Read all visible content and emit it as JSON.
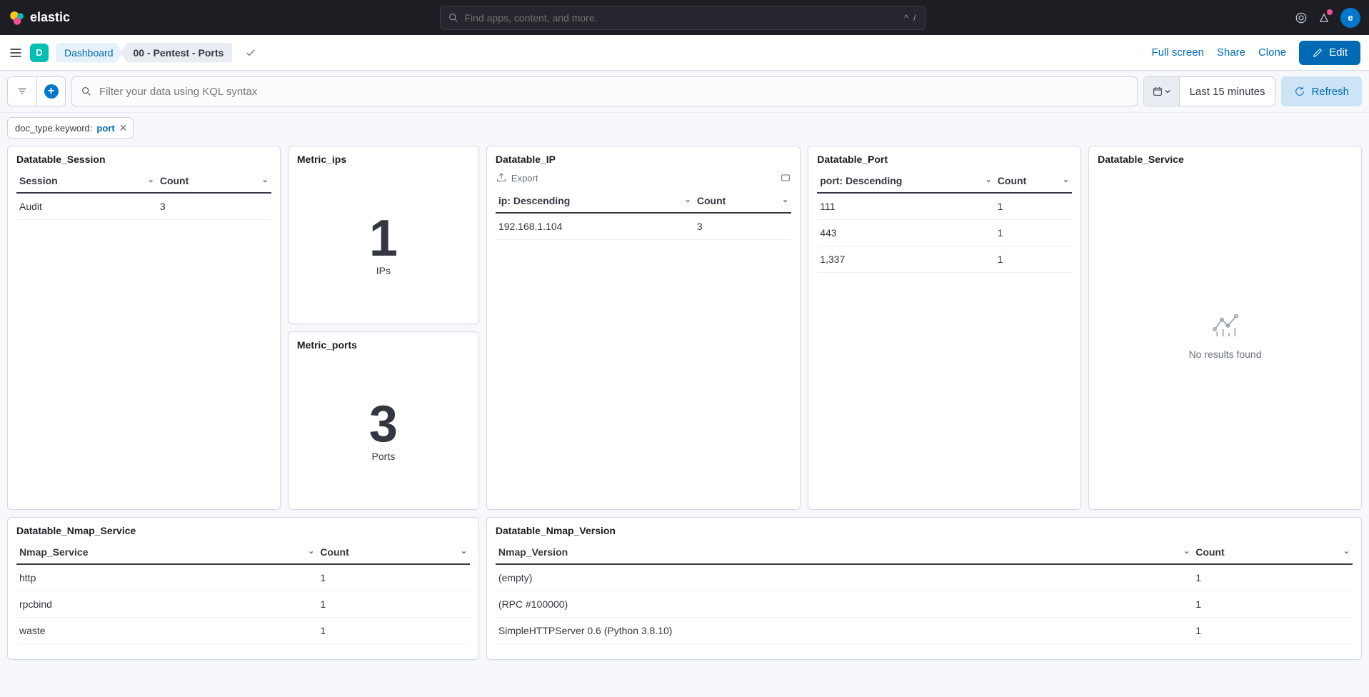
{
  "header": {
    "logo_text": "elastic",
    "search_placeholder": "Find apps, content, and more.",
    "search_kbd": "^ /",
    "avatar_letter": "e"
  },
  "subheader": {
    "space_letter": "D",
    "breadcrumb_dashboard": "Dashboard",
    "breadcrumb_current": "00 - Pentest - Ports",
    "full_screen": "Full screen",
    "share": "Share",
    "clone": "Clone",
    "edit": "Edit"
  },
  "filterbar": {
    "kql_placeholder": "Filter your data using KQL syntax",
    "time_range": "Last 15 minutes",
    "refresh": "Refresh"
  },
  "filter_pill": {
    "key": "doc_type.keyword:",
    "value": "port"
  },
  "panels": {
    "session": {
      "title": "Datatable_Session",
      "col1": "Session",
      "col2": "Count",
      "row1_c1": "Audit",
      "row1_c2": "3"
    },
    "metric_ips": {
      "title": "Metric_ips",
      "value": "1",
      "label": "IPs"
    },
    "metric_ports": {
      "title": "Metric_ports",
      "value": "3",
      "label": "Ports"
    },
    "ip": {
      "title": "Datatable_IP",
      "export": "Export",
      "col1": "ip: Descending",
      "col2": "Count",
      "row1_c1": "192.168.1.104",
      "row1_c2": "3"
    },
    "port": {
      "title": "Datatable_Port",
      "col1": "port: Descending",
      "col2": "Count",
      "r1c1": "111",
      "r1c2": "1",
      "r2c1": "443",
      "r2c2": "1",
      "r3c1": "1,337",
      "r3c2": "1"
    },
    "service": {
      "title": "Datatable_Service",
      "no_results": "No results found"
    },
    "nmap_service": {
      "title": "Datatable_Nmap_Service",
      "col1": "Nmap_Service",
      "col2": "Count",
      "r1c1": "http",
      "r1c2": "1",
      "r2c1": "rpcbind",
      "r2c2": "1",
      "r3c1": "waste",
      "r3c2": "1"
    },
    "nmap_version": {
      "title": "Datatable_Nmap_Version",
      "col1": "Nmap_Version",
      "col2": "Count",
      "r1c1": "(empty)",
      "r1c2": "1",
      "r2c1": "(RPC #100000)",
      "r2c2": "1",
      "r3c1": "SimpleHTTPServer 0.6 (Python 3.8.10)",
      "r3c2": "1"
    }
  }
}
